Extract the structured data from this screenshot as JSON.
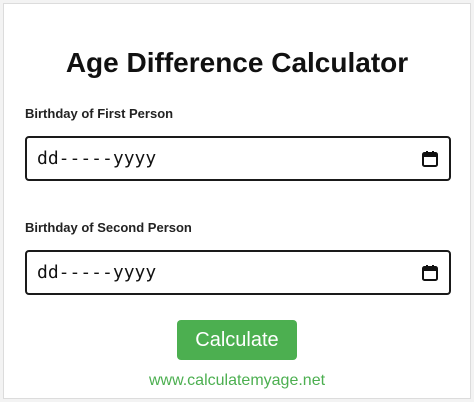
{
  "page": {
    "title": "Age Difference Calculator"
  },
  "form": {
    "first_label": "Birthday of First Person",
    "first_value": "dd-----yyyy",
    "second_label": "Birthday of Second Person",
    "second_value": "dd-----yyyy",
    "calendar_icon": "calendar-icon"
  },
  "actions": {
    "calculate_label": "Calculate"
  },
  "footer": {
    "site_link": "www.calculatemyage.net"
  },
  "colors": {
    "accent": "#4caf50",
    "border": "#1a1a1a",
    "text": "#111111"
  }
}
